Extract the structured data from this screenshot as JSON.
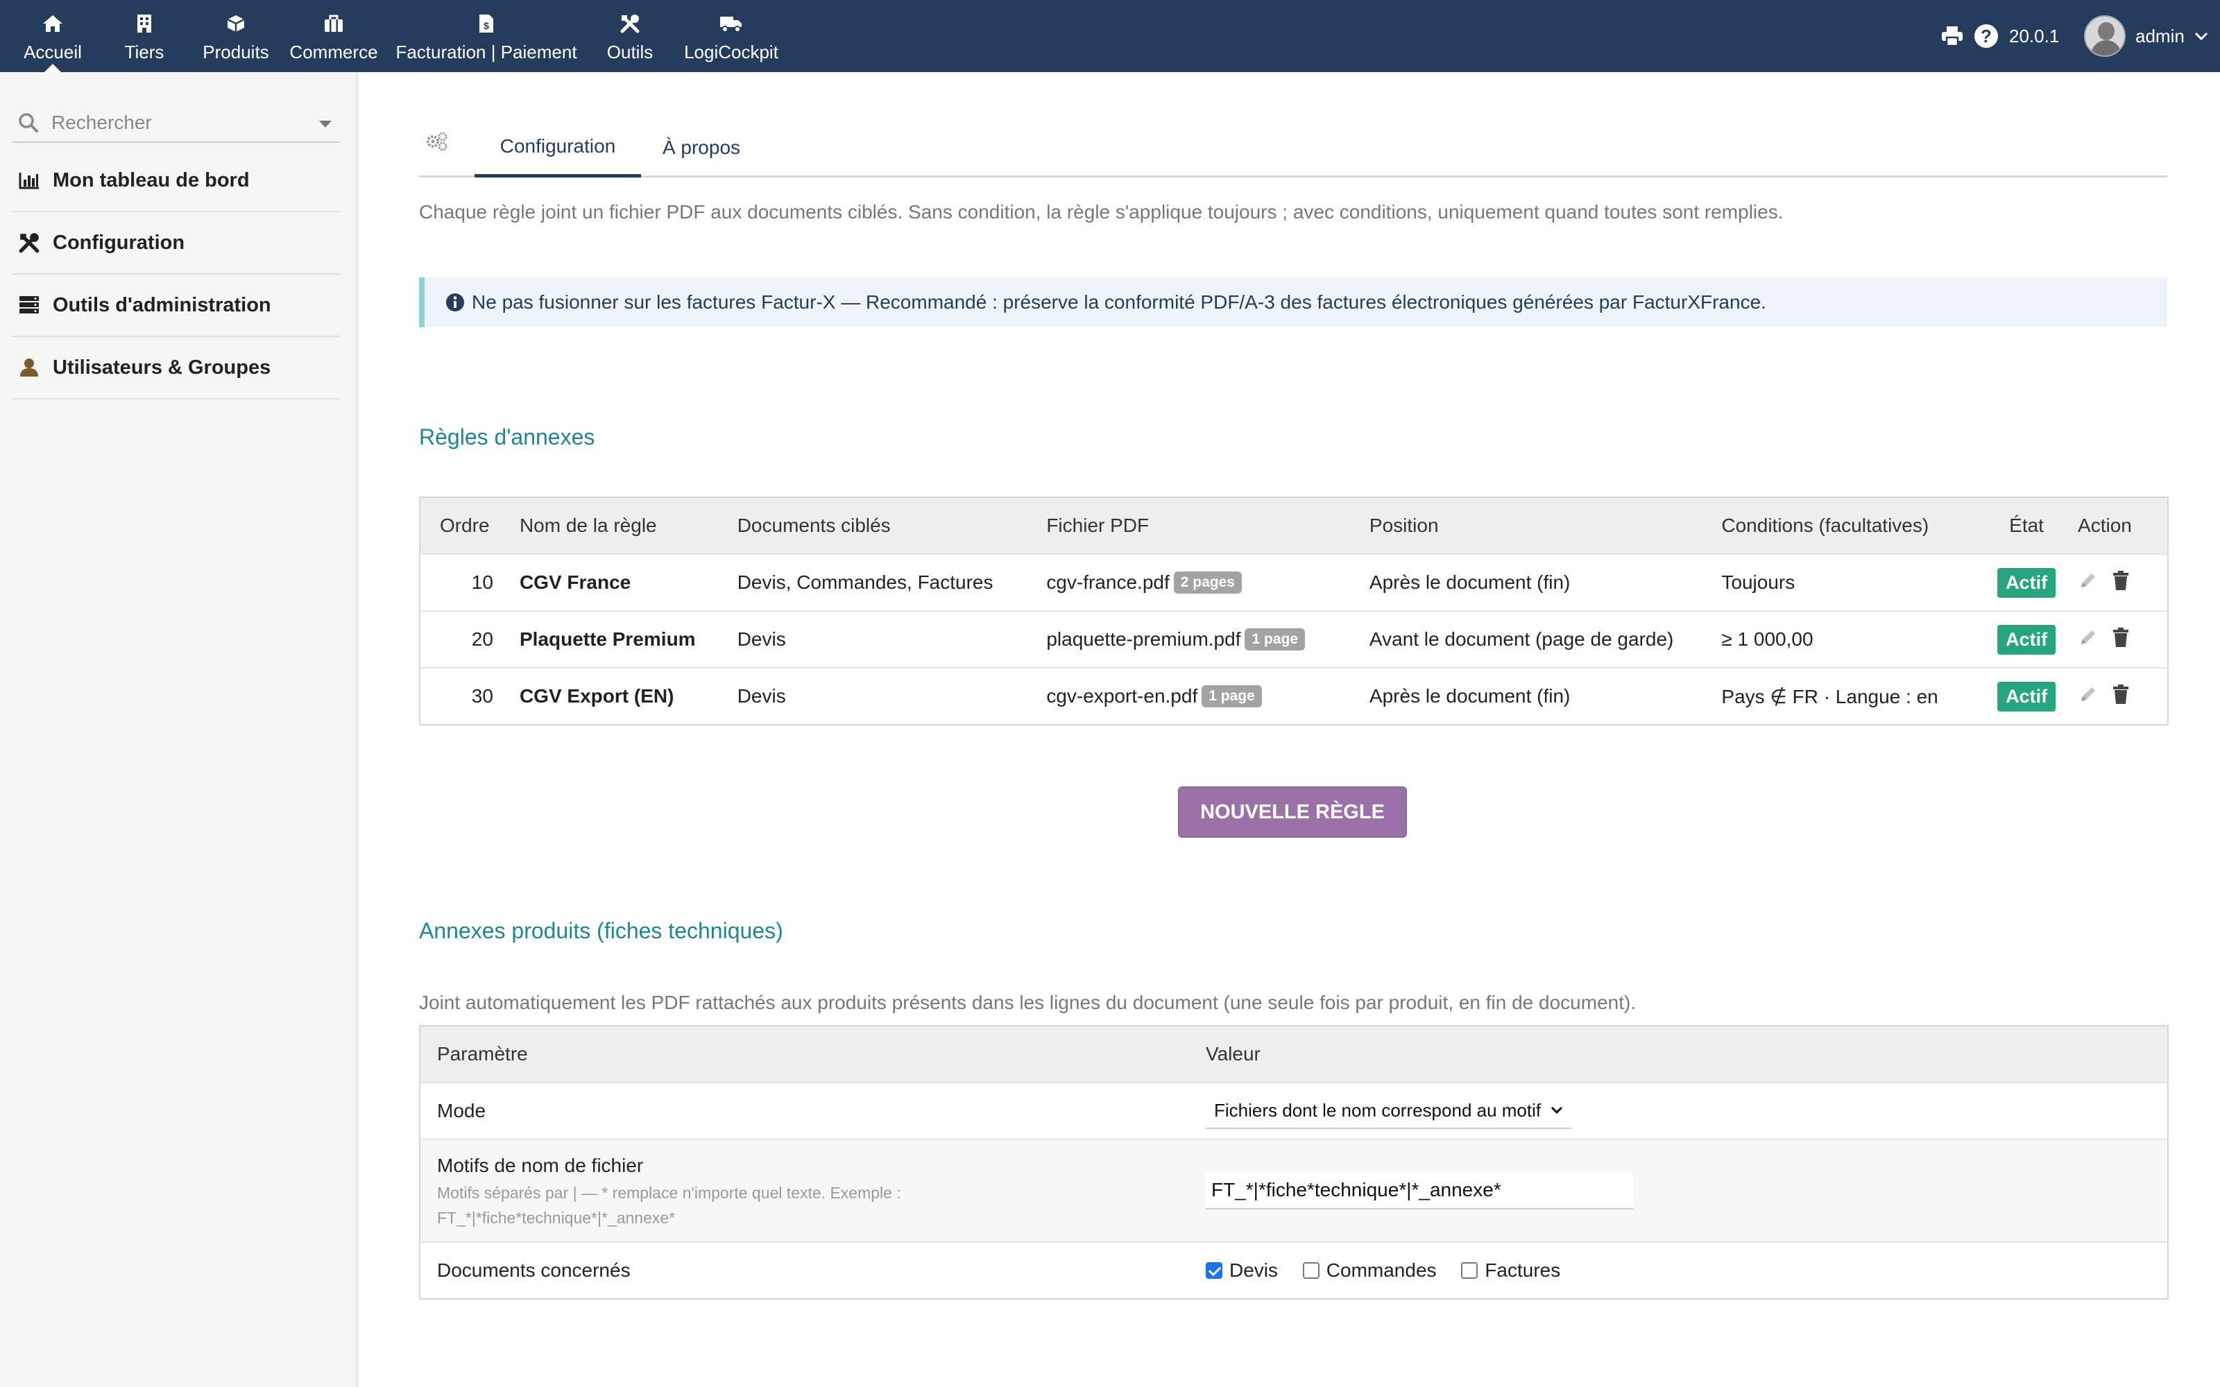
{
  "topnav": {
    "items": [
      {
        "label": "Accueil",
        "icon": "home-icon"
      },
      {
        "label": "Tiers",
        "icon": "building-icon"
      },
      {
        "label": "Produits",
        "icon": "cube-icon"
      },
      {
        "label": "Commerce",
        "icon": "briefcase-icon"
      },
      {
        "label": "Facturation | Paiement",
        "icon": "invoice-icon"
      },
      {
        "label": "Outils",
        "icon": "tools-icon"
      },
      {
        "label": "LogiCockpit",
        "icon": "truck-icon"
      }
    ],
    "version": "20.0.1",
    "user": "admin"
  },
  "sidebar": {
    "search_placeholder": "Rechercher",
    "items": [
      {
        "label": "Mon tableau de bord",
        "icon": "chart-icon"
      },
      {
        "label": "Configuration",
        "icon": "tools-icon"
      },
      {
        "label": "Outils d'administration",
        "icon": "server-icon"
      },
      {
        "label": "Utilisateurs & Groupes",
        "icon": "user-icon"
      }
    ]
  },
  "tabs": {
    "config": "Configuration",
    "about": "À propos"
  },
  "intro": "Chaque règle joint un fichier PDF aux documents ciblés. Sans condition, la règle s'applique toujours ; avec conditions, uniquement quand toutes sont remplies.",
  "info": "Ne pas fusionner sur les factures Factur-X — Recommandé : préserve la conformité PDF/A-3 des factures électroniques générées par FacturXFrance.",
  "rules": {
    "title": "Règles d'annexes",
    "headers": {
      "order": "Ordre",
      "name": "Nom de la règle",
      "docs": "Documents ciblés",
      "file": "Fichier PDF",
      "position": "Position",
      "conditions": "Conditions (facultatives)",
      "state": "État",
      "action": "Action"
    },
    "rows": [
      {
        "order": "10",
        "name": "CGV France",
        "docs": "Devis, Commandes, Factures",
        "file": "cgv-france.pdf",
        "pages": "2 pages",
        "position": "Après le document (fin)",
        "conditions": "Toujours",
        "state": "Actif"
      },
      {
        "order": "20",
        "name": "Plaquette Premium",
        "docs": "Devis",
        "file": "plaquette-premium.pdf",
        "pages": "1 page",
        "position": "Avant le document (page de garde)",
        "conditions": "≥ 1 000,00",
        "state": "Actif"
      },
      {
        "order": "30",
        "name": "CGV Export (EN)",
        "docs": "Devis",
        "file": "cgv-export-en.pdf",
        "pages": "1 page",
        "position": "Après le document (fin)",
        "conditions": "Pays ∉ FR · Langue : en",
        "state": "Actif"
      }
    ],
    "new_button": "NOUVELLE RÈGLE"
  },
  "products": {
    "title": "Annexes produits (fiches techniques)",
    "description": "Joint automatiquement les PDF rattachés aux produits présents dans les lignes du document (une seule fois par produit, en fin de document).",
    "headers": {
      "param": "Paramètre",
      "value": "Valeur"
    },
    "mode_label": "Mode",
    "mode_value": "Fichiers dont le nom correspond au motif",
    "patterns_label": "Motifs de nom de fichier",
    "patterns_hint_1": "Motifs séparés par | — * remplace n'importe quel texte. Exemple :",
    "patterns_hint_2": "FT_*|*fiche*technique*|*_annexe*",
    "patterns_value": "FT_*|*fiche*technique*|*_annexe*",
    "docs_label": "Documents concernés",
    "checkboxes": [
      {
        "label": "Devis",
        "checked": true
      },
      {
        "label": "Commandes",
        "checked": false
      },
      {
        "label": "Factures",
        "checked": false
      }
    ]
  },
  "colors": {
    "topbar": "#263c5c",
    "accent_teal": "#20858f",
    "status_green": "#25a580",
    "button_purple": "#9b72a8"
  }
}
